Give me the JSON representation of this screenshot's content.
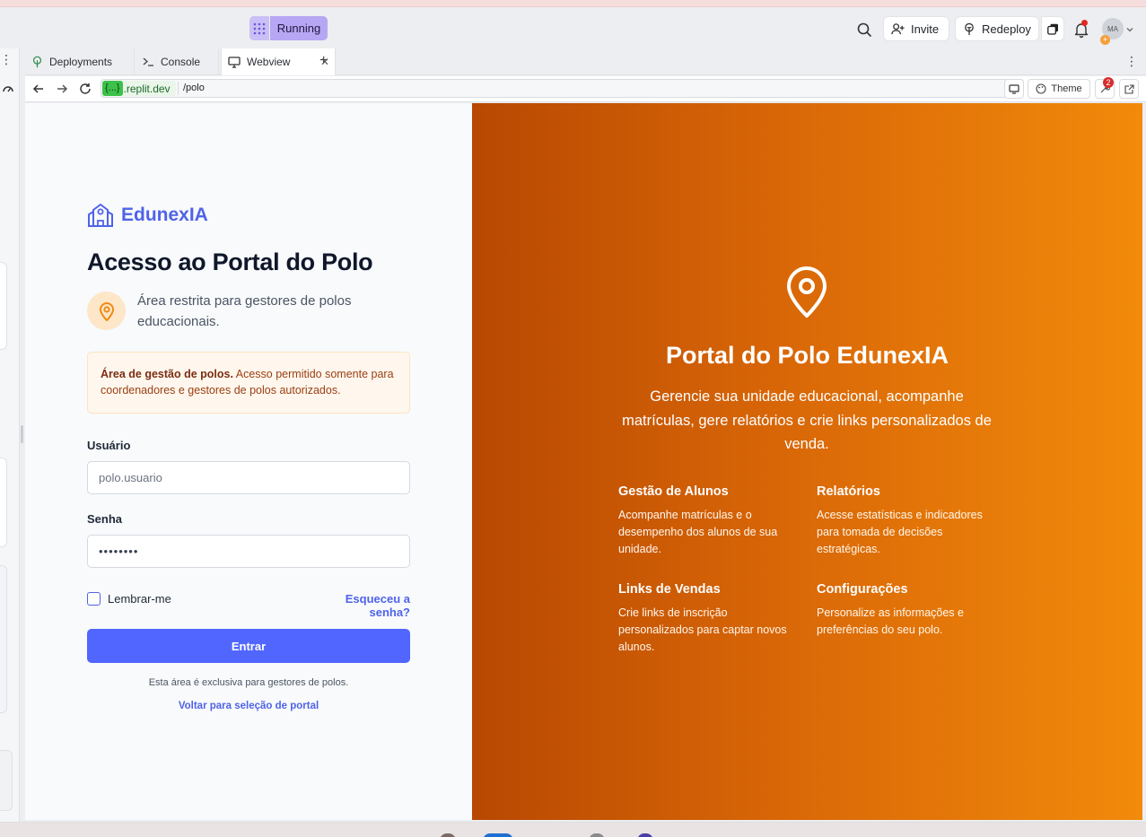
{
  "topbar": {
    "run_status": "Running",
    "invite_label": "Invite",
    "redeploy_label": "Redeploy",
    "avatar_initials": "MA",
    "avatar_badge": "+"
  },
  "tabs": [
    {
      "label": "Deployments"
    },
    {
      "label": "Console"
    },
    {
      "label": "Webview"
    }
  ],
  "urlbar": {
    "host_chip": "{...}",
    "host": ".replit.dev",
    "path": "/polo",
    "theme_label": "Theme",
    "devtools_badge": "2"
  },
  "login": {
    "brand_name": "EdunexIA",
    "title": "Acesso ao Portal do Polo",
    "subtitle": "Área restrita para gestores de polos educacionais.",
    "notice_bold": "Área de gestão de polos.",
    "notice_text": " Acesso permitido somente para coordenadores e gestores de polos autorizados.",
    "username_label": "Usuário",
    "username_placeholder": "polo.usuario",
    "password_label": "Senha",
    "password_value": "••••••••",
    "remember_label": "Lembrar-me",
    "forgot_label": "Esqueceu a senha?",
    "submit_label": "Entrar",
    "footnote": "Esta área é exclusiva para gestores de polos.",
    "back_link": "Voltar para seleção de portal"
  },
  "hero": {
    "title": "Portal do Polo EdunexIA",
    "description": "Gerencie sua unidade educacional, acompanhe matrículas, gere relatórios e crie links personalizados de venda.",
    "features": [
      {
        "title": "Gestão de Alunos",
        "desc": "Acompanhe matrículas e o desempenho dos alunos de sua unidade."
      },
      {
        "title": "Relatórios",
        "desc": "Acesse estatísticas e indicadores para tomada de decisões estratégicas."
      },
      {
        "title": "Links de Vendas",
        "desc": "Crie links de inscrição personalizados para captar novos alunos."
      },
      {
        "title": "Configurações",
        "desc": "Personalize as informações e preferências do seu polo."
      }
    ]
  },
  "colors": {
    "brand_blue": "#4f63e8",
    "button_blue": "#5166ff",
    "gradient_start": "#b84802",
    "gradient_end": "#f28a0b",
    "running_purple": "#b7a6f3"
  },
  "icons": [
    "grid-icon",
    "search-icon",
    "user-plus-icon",
    "redeploy-icon",
    "stack-icon",
    "bell-icon",
    "deployments-icon",
    "terminal-icon",
    "monitor-icon",
    "back-arrow-icon",
    "forward-arrow-icon",
    "reload-icon",
    "palette-icon",
    "wrench-icon",
    "external-link-icon",
    "school-icon",
    "map-pin-icon"
  ]
}
